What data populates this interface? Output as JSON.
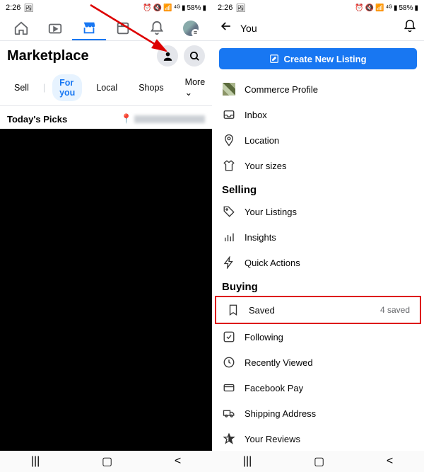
{
  "status": {
    "time": "2:26",
    "battery": "58%",
    "indicator": "🖼",
    "icons_signal": "📶",
    "icons_lte": "⁴ᴳ"
  },
  "left": {
    "title": "Marketplace",
    "filters": {
      "sell": "Sell",
      "foryou": "For you",
      "local": "Local",
      "shops": "Shops",
      "more": "More"
    },
    "picks": "Today's Picks"
  },
  "right": {
    "title": "You",
    "create": "Create New Listing",
    "items": {
      "commerce": "Commerce Profile",
      "inbox": "Inbox",
      "location": "Location",
      "sizes": "Your sizes"
    },
    "selling": {
      "heading": "Selling",
      "listings": "Your Listings",
      "insights": "Insights",
      "quick": "Quick Actions"
    },
    "buying": {
      "heading": "Buying",
      "saved": "Saved",
      "saved_count": "4 saved",
      "following": "Following",
      "recent": "Recently Viewed",
      "pay": "Facebook Pay",
      "shipping": "Shipping Address",
      "reviews": "Your Reviews"
    }
  }
}
